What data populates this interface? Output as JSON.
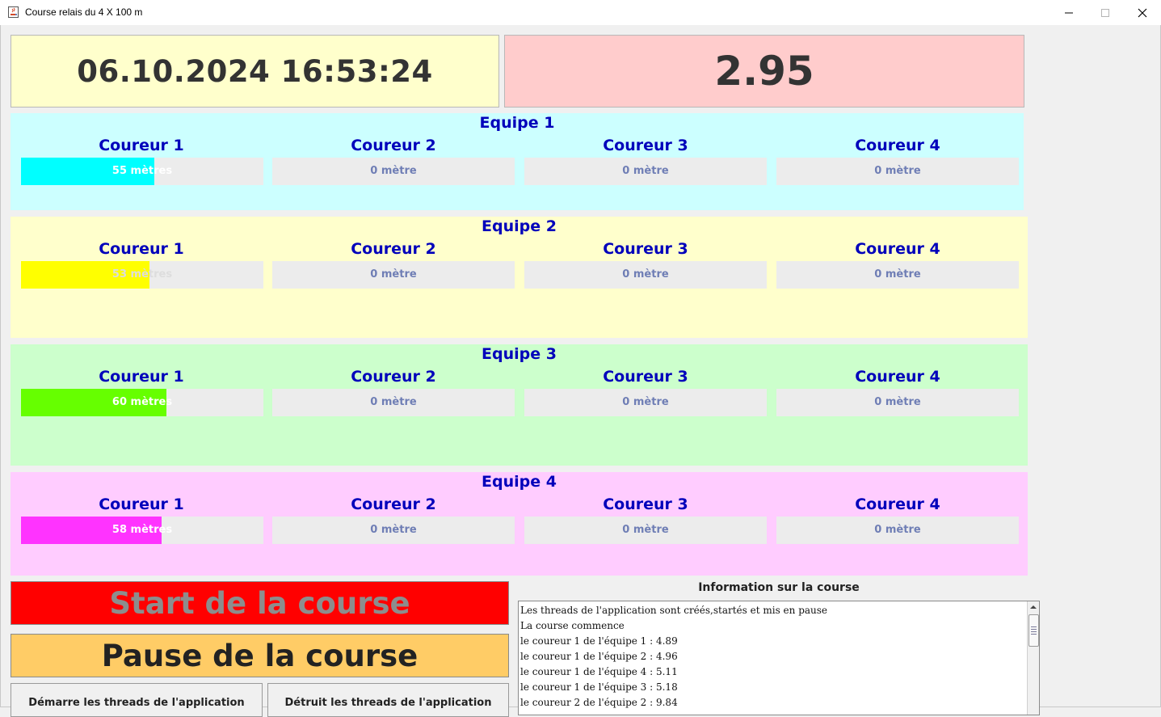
{
  "window": {
    "title": "Course relais du 4 X 100 m",
    "controls": [
      "minimize-icon",
      "maximize-icon",
      "close-icon"
    ]
  },
  "clock": {
    "datetime": "06.10.2024 16:53:24"
  },
  "chrono": {
    "value": "2.95"
  },
  "teams": [
    {
      "title": "Equipe 1",
      "background": "#ccffff",
      "fill_color": "#00ffff",
      "runners": [
        {
          "label": "Coureur 1",
          "distance": "55 mètres",
          "progress": 0.55
        },
        {
          "label": "Coureur 2",
          "distance": "0 mètre",
          "progress": 0
        },
        {
          "label": "Coureur 3",
          "distance": "0 mètre",
          "progress": 0
        },
        {
          "label": "Coureur 4",
          "distance": "0 mètre",
          "progress": 0
        }
      ]
    },
    {
      "title": "Equipe 2",
      "background": "#ffffcc",
      "fill_color": "#ffff00",
      "runners": [
        {
          "label": "Coureur 1",
          "distance": "53 mètres",
          "progress": 0.53
        },
        {
          "label": "Coureur 2",
          "distance": "0 mètre",
          "progress": 0
        },
        {
          "label": "Coureur 3",
          "distance": "0 mètre",
          "progress": 0
        },
        {
          "label": "Coureur 4",
          "distance": "0 mètre",
          "progress": 0
        }
      ]
    },
    {
      "title": "Equipe 3",
      "background": "#ccffcc",
      "fill_color": "#66ff00",
      "runners": [
        {
          "label": "Coureur 1",
          "distance": "60 mètres",
          "progress": 0.6
        },
        {
          "label": "Coureur 2",
          "distance": "0 mètre",
          "progress": 0
        },
        {
          "label": "Coureur 3",
          "distance": "0 mètre",
          "progress": 0
        },
        {
          "label": "Coureur 4",
          "distance": "0 mètre",
          "progress": 0
        }
      ]
    },
    {
      "title": "Equipe 4",
      "background": "#ffccff",
      "fill_color": "#ff33ff",
      "runners": [
        {
          "label": "Coureur 1",
          "distance": "58 mètres",
          "progress": 0.58
        },
        {
          "label": "Coureur 2",
          "distance": "0 mètre",
          "progress": 0
        },
        {
          "label": "Coureur 3",
          "distance": "0 mètre",
          "progress": 0
        },
        {
          "label": "Coureur 4",
          "distance": "0 mètre",
          "progress": 0
        }
      ]
    }
  ],
  "buttons": {
    "start": "Start de la course",
    "pause": "Pause de la course",
    "start_threads": "Démarre les threads de l'application",
    "destroy_threads": "Détruit les threads de l'application"
  },
  "info": {
    "title": "Information sur la course",
    "lines": [
      "Les threads de l'application sont créés,startés et mis en pause",
      "La course commence",
      "le coureur 1 de l'équipe 1 : 4.89",
      "le coureur 1 de l'équipe 2 : 4.96",
      "le coureur 1 de l'équipe 4 : 5.11",
      "le coureur 1 de l'équipe 3 : 5.18",
      "le coureur 2 de l'équipe 2 : 9.84"
    ]
  }
}
